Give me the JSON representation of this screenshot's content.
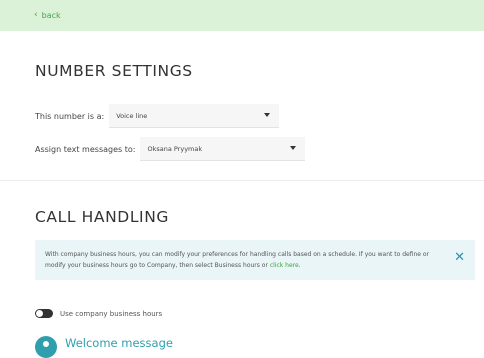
{
  "nav": {
    "back_label": "back"
  },
  "number_settings": {
    "title": "NUMBER SETTINGS",
    "line_type": {
      "label": "This number is a:",
      "value": "Voice line"
    },
    "assign": {
      "label": "Assign text messages to:",
      "value": "Oksana Pryymak"
    }
  },
  "call_handling": {
    "title": "CALL HANDLING",
    "info": {
      "text": "With company business hours, you can modify your preferences for handling calls based on a schedule. If you want to define or modify your business hours go to Company, then select Business hours or ",
      "link": "click here",
      "text_end": "."
    },
    "business_hours_toggle": {
      "label": "Use company business hours",
      "on": false
    },
    "welcome": {
      "label": "Welcome message"
    }
  },
  "colors": {
    "topbar_bg": "#dcf2d8",
    "accent_green": "#4aa24a",
    "accent_teal": "#2f9fae",
    "info_bg": "#e9f5f7"
  },
  "icons": {
    "back": "chevron-left-icon",
    "dropdown": "caret-down-icon",
    "close": "close-icon",
    "welcome": "message-icon"
  }
}
